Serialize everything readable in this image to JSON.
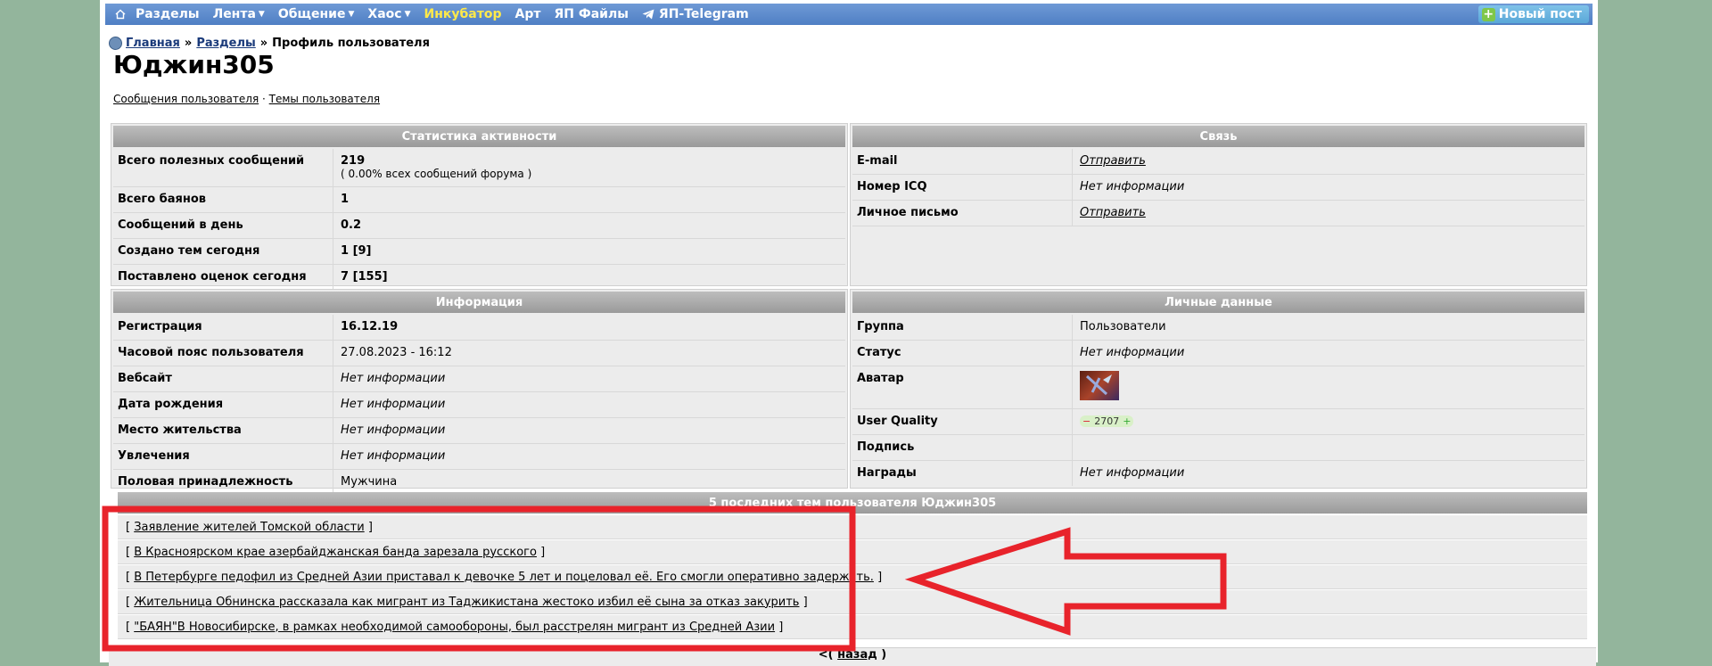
{
  "nav": {
    "items": [
      "Разделы",
      "Лента",
      "Общение",
      "Хаос",
      "Инкубатор",
      "Арт",
      "ЯП Файлы",
      "ЯП-Telegram"
    ],
    "new_post": "Новый пост"
  },
  "breadcrumb": {
    "home": "Главная",
    "sep": "»",
    "sections": "Разделы",
    "current": "Профиль пользователя"
  },
  "user": {
    "name": "Юджин305",
    "link_messages": "Сообщения пользователя",
    "link_sep": "·",
    "link_topics": "Темы пользователя"
  },
  "stats": {
    "title": "Статистика активности",
    "rows": [
      {
        "k": "Всего полезных сообщений",
        "v": "219",
        "v2": "( 0.00% всех сообщений форума )"
      },
      {
        "k": "Всего баянов",
        "v": "1"
      },
      {
        "k": "Сообщений в день",
        "v": "0.2"
      },
      {
        "k": "Создано тем сегодня",
        "v": "1 [9]"
      },
      {
        "k": "Поставлено оценок сегодня",
        "v": "7 [155]"
      }
    ]
  },
  "contact": {
    "title": "Связь",
    "rows": [
      {
        "k": "E-mail",
        "v": "Отправить"
      },
      {
        "k": "Номер ICQ",
        "v": "Нет информации"
      },
      {
        "k": "Личное письмо",
        "v": "Отправить"
      }
    ]
  },
  "info": {
    "title": "Информация",
    "rows": [
      {
        "k": "Регистрация",
        "v": "16.12.19"
      },
      {
        "k": "Часовой пояс пользователя",
        "v": "27.08.2023 - 16:12"
      },
      {
        "k": "Вебсайт",
        "v": "Нет информации"
      },
      {
        "k": "Дата рождения",
        "v": "Нет информации"
      },
      {
        "k": "Место жительства",
        "v": "Нет информации"
      },
      {
        "k": "Увлечения",
        "v": "Нет информации"
      },
      {
        "k": "Половая принадлежность",
        "v": "Мужчина"
      }
    ]
  },
  "personal": {
    "title": "Личные данные",
    "rows": [
      {
        "k": "Группа",
        "v": "Пользователи"
      },
      {
        "k": "Статус",
        "v": "Нет информации"
      },
      {
        "k": "Аватар",
        "v": ""
      },
      {
        "k": "User Quality",
        "v": "2707",
        "minus": "−",
        "plus": "+"
      },
      {
        "k": "Подпись",
        "v": ""
      },
      {
        "k": "Награды",
        "v": "Нет информации"
      }
    ]
  },
  "posts": {
    "title": "5 последних тем пользователя Юджин305",
    "items": [
      "Заявление жителей Томской области",
      "В Красноярском крае азербайджанская банда зарезала русского",
      "В Петербурге педофил из Средней Азии приставал к девочке 5 лет и поцеловал её. Его смогли оперативно задержать.",
      "Жительница Обнинска рассказала как мигрант из Таджикистана жестоко избил её сына за отказ закурить",
      "\"БАЯН\"В Новосибирске, в рамках необходимой самообороны, был расстрелян мигрант из Средней Азии"
    ],
    "bracket_open": "[",
    "bracket_close": "]"
  },
  "back": {
    "prefix": "<(",
    "label": "назад",
    "suffix": ")"
  },
  "colors": {
    "nav": "#4f7fc4",
    "incubator": "#ffe94a",
    "annotation": "#e8232b"
  }
}
